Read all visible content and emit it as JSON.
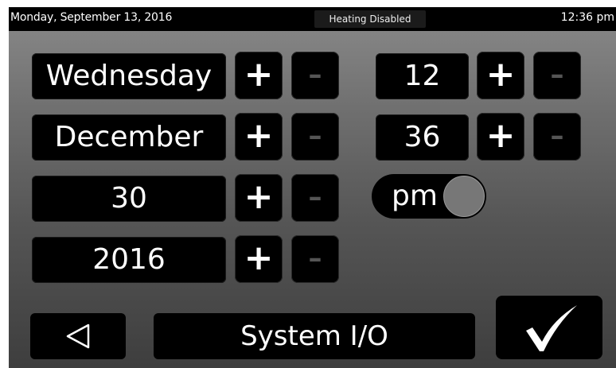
{
  "status_bar": {
    "date": "Monday, September 13, 2016",
    "heating_status": "Heating Disabled",
    "time": "12:36 pm"
  },
  "fields": {
    "weekday": "Wednesday",
    "month": "December",
    "day": "30",
    "year": "2016",
    "hour": "12",
    "minute": "36",
    "ampm": "pm"
  },
  "buttons": {
    "plus": "+",
    "minus": "–",
    "system": "System I/O"
  },
  "icons": {
    "back": "back-triangle-icon",
    "confirm": "checkmark-icon"
  }
}
